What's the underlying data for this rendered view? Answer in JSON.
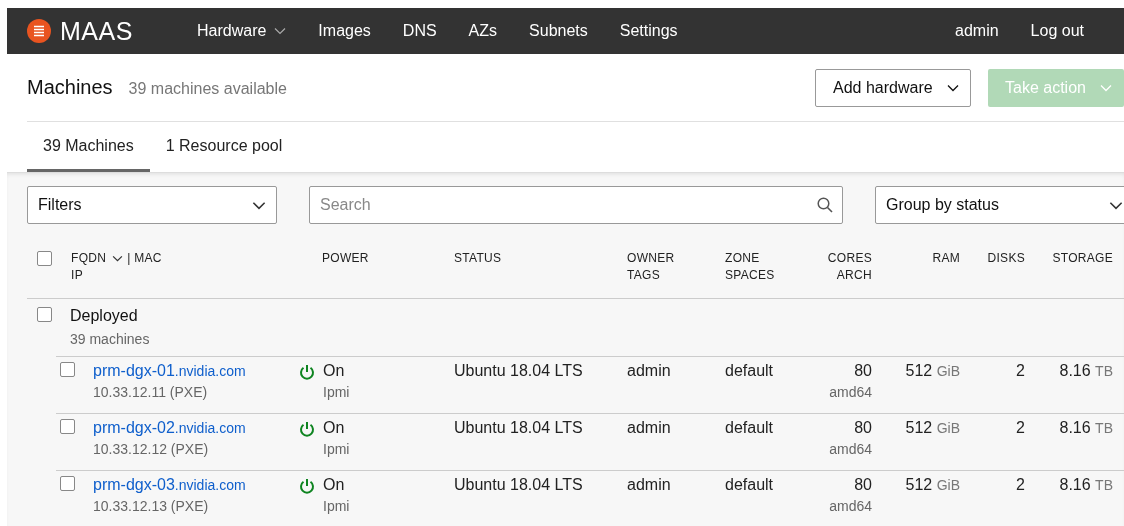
{
  "navbar": {
    "logo": "MAAS",
    "items": [
      {
        "label": "Hardware",
        "dropdown": true
      },
      {
        "label": "Images",
        "dropdown": false
      },
      {
        "label": "DNS",
        "dropdown": false
      },
      {
        "label": "AZs",
        "dropdown": false
      },
      {
        "label": "Subnets",
        "dropdown": false
      },
      {
        "label": "Settings",
        "dropdown": false
      }
    ],
    "user": "admin",
    "logout": "Log out"
  },
  "header": {
    "title": "Machines",
    "subtitle": "39 machines available",
    "buttons": [
      {
        "label": "Add hardware",
        "disabled": false
      },
      {
        "label": "Take action",
        "disabled": true
      }
    ]
  },
  "tabs": [
    {
      "label": "39 Machines",
      "selected": true
    },
    {
      "label": "1 Resource pool",
      "selected": false
    }
  ],
  "filters": {
    "filter_select": "Filters",
    "search": {
      "placeholder": "Search"
    },
    "group_select": "Group by status"
  },
  "table": {
    "select_all_checked": false,
    "columns": [
      [
        "FQDN",
        "| MAC",
        "IP"
      ],
      [
        "POWER"
      ],
      [
        "STATUS"
      ],
      [
        "OWNER",
        "TAGS"
      ],
      [
        "ZONE",
        "SPACES"
      ],
      [
        "CORES",
        "ARCH"
      ],
      [
        "RAM"
      ],
      [
        "DISKS"
      ],
      [
        "STORAGE"
      ]
    ],
    "groups": [
      {
        "name": "Deployed",
        "count": "39 machines",
        "checked": false,
        "rows": [
          {
            "host": "prm-dgx-01",
            "domain": ".nvidia.com",
            "ip": "10.33.12.11 (PXE)",
            "power": "On",
            "power_on": true,
            "power_type": "Ipmi",
            "status": "Ubuntu 18.04 LTS",
            "owner": "admin",
            "zone": "default",
            "cores": "80",
            "arch": "amd64",
            "ram": "512",
            "ram_unit": "GiB",
            "disks": "2",
            "storage": "8.16",
            "storage_unit": "TB",
            "checked": false
          },
          {
            "host": "prm-dgx-02",
            "domain": ".nvidia.com",
            "ip": "10.33.12.12 (PXE)",
            "power": "On",
            "power_on": true,
            "power_type": "Ipmi",
            "status": "Ubuntu 18.04 LTS",
            "owner": "admin",
            "zone": "default",
            "cores": "80",
            "arch": "amd64",
            "ram": "512",
            "ram_unit": "GiB",
            "disks": "2",
            "storage": "8.16",
            "storage_unit": "TB",
            "checked": false
          },
          {
            "host": "prm-dgx-03",
            "domain": ".nvidia.com",
            "ip": "10.33.12.13 (PXE)",
            "power": "On",
            "power_on": true,
            "power_type": "Ipmi",
            "status": "Ubuntu 18.04 LTS",
            "owner": "admin",
            "zone": "default",
            "cores": "80",
            "arch": "amd64",
            "ram": "512",
            "ram_unit": "GiB",
            "disks": "2",
            "storage": "8.16",
            "storage_unit": "TB",
            "checked": false
          }
        ]
      }
    ]
  }
}
